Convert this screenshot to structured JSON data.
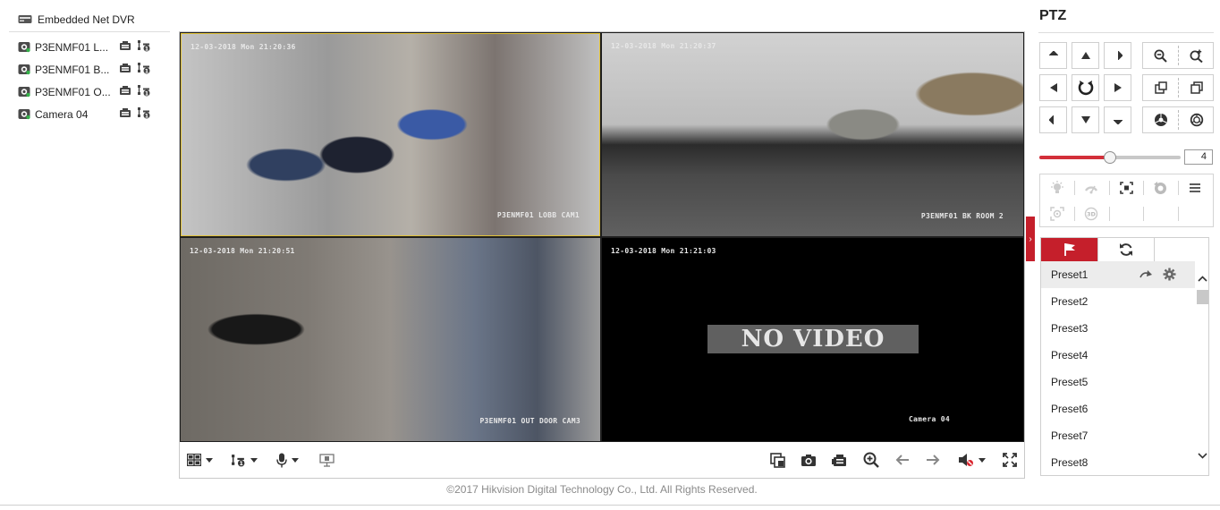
{
  "device": {
    "name": "Embedded Net DVR"
  },
  "cameras": [
    {
      "name": "P3ENMF01 L..."
    },
    {
      "name": "P3ENMF01 B..."
    },
    {
      "name": "P3ENMF01 O..."
    },
    {
      "name": "Camera 04"
    }
  ],
  "video": {
    "windows": [
      {
        "time": "12-03-2018 Mon 21:20:36",
        "channel": "P3ENMF01 LOBB  CAM1",
        "status": ""
      },
      {
        "time": "12-03-2018 Mon 21:20:37",
        "channel": "P3ENMF01 BK ROOM 2",
        "status": ""
      },
      {
        "time": "12-03-2018 Mon 21:20:51",
        "channel": "P3ENMF01 OUT DOOR CAM3",
        "status": ""
      },
      {
        "time": "12-03-2018 Mon 21:21:03",
        "channel": "Camera 04",
        "status": "NO VIDEO"
      }
    ],
    "selected_window": 1
  },
  "toolbar": {
    "left": [
      "window-layout-icon",
      "ptz-stream-icon",
      "microphone-icon",
      "digital-zoom-display-icon"
    ],
    "right": [
      "capture-all-icon",
      "camera-snapshot-icon",
      "record-icon",
      "zoom-in-icon",
      "previous-page-icon",
      "next-page-icon",
      "mute-icon",
      "fullscreen-icon"
    ]
  },
  "footer": {
    "copyright": "©2017 Hikvision Digital Technology Co., Ltd. All Rights Reserved."
  },
  "ptz": {
    "title": "PTZ",
    "speed": {
      "value": "4",
      "min": 1,
      "max": 7,
      "level": 4
    },
    "presets": [
      "Preset1",
      "Preset2",
      "Preset3",
      "Preset4",
      "Preset5",
      "Preset6",
      "Preset7",
      "Preset8"
    ],
    "selected_preset": 0
  },
  "colors": {
    "accent": "#c51f2b",
    "selected_border": "#e1c238",
    "no_video_bg": "#606060"
  }
}
